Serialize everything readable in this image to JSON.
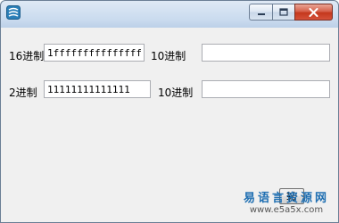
{
  "window": {
    "title": "",
    "caption_buttons": [
      "minimize-icon",
      "maximize-icon",
      "close-icon"
    ]
  },
  "row1": {
    "label_hex": "16进制",
    "hex_value": "1ffffffffffffffff",
    "label_dec": "10进制",
    "dec_value": ""
  },
  "row2": {
    "label_bin": "2进制",
    "bin_value": "11111111111111",
    "label_dec": "10进制",
    "dec_value": ""
  },
  "convert_button": {
    "label": "转"
  },
  "watermark": {
    "brand": "易语言资源网",
    "url": "www.e5a5x.com"
  },
  "colors": {
    "accent": "#1f6fb2",
    "close": "#c4381d"
  }
}
